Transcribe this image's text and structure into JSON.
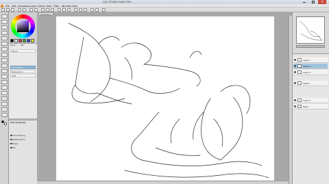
{
  "app": {
    "title": "CLIP STUDIO PAINT PRO"
  },
  "window_controls": [
    "minimize",
    "maximize",
    "close"
  ],
  "menu": [
    "File",
    "Edit",
    "Animation",
    "Layer",
    "Select",
    "View",
    "Filter",
    "Window",
    "Help"
  ],
  "document_tabs": [
    "Illustration"
  ],
  "sub_tool": {
    "tabs": [
      "Pencil",
      "Pen"
    ],
    "items": [
      "Pencil",
      "Mechanical",
      "Real pencil",
      "Soft"
    ],
    "selected_index": 1
  },
  "tool_property": {
    "header": "Tool property",
    "options": [
      "Anti-aliasing",
      "Stabilization",
      "Taper",
      "Fill"
    ]
  },
  "layers": [
    {
      "name": "Layer 1",
      "selected": false
    },
    {
      "name": "Layer 2",
      "selected": true
    },
    {
      "name": "Layer 3",
      "selected": false
    },
    {
      "name": "Sketch",
      "selected": false
    },
    {
      "name": "Layer 4",
      "selected": false
    },
    {
      "name": "Paper",
      "selected": false
    }
  ],
  "colors": {
    "main": "#000000",
    "sub": "#ffffff",
    "accent": "#8fb9d6"
  }
}
